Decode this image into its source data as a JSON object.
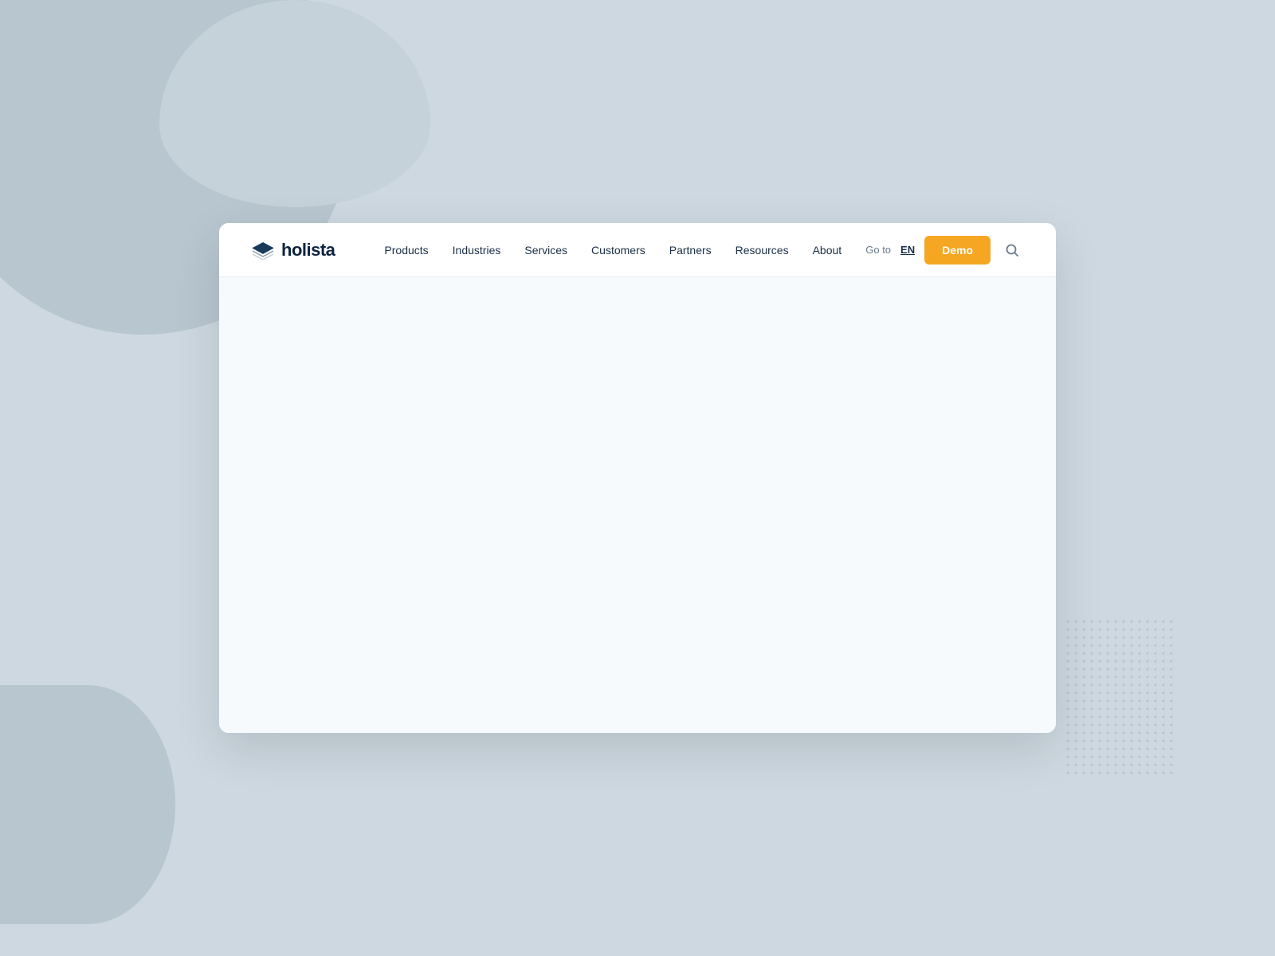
{
  "background": {
    "color": "#cdd8e0"
  },
  "logo": {
    "text": "holista",
    "icon": "layers-icon"
  },
  "navbar": {
    "links": [
      {
        "label": "Products",
        "id": "nav-products"
      },
      {
        "label": "Industries",
        "id": "nav-industries"
      },
      {
        "label": "Services",
        "id": "nav-services"
      },
      {
        "label": "Customers",
        "id": "nav-customers"
      },
      {
        "label": "Partners",
        "id": "nav-partners"
      },
      {
        "label": "Resources",
        "id": "nav-resources"
      },
      {
        "label": "About",
        "id": "nav-about"
      }
    ],
    "goto_label": "Go to",
    "language": "EN",
    "demo_button": "Demo"
  },
  "main": {
    "background": "#f7fafc"
  },
  "dot_grid": {
    "color": "#b0b8c4",
    "cols": 14,
    "rows": 20,
    "spacing": 10
  }
}
